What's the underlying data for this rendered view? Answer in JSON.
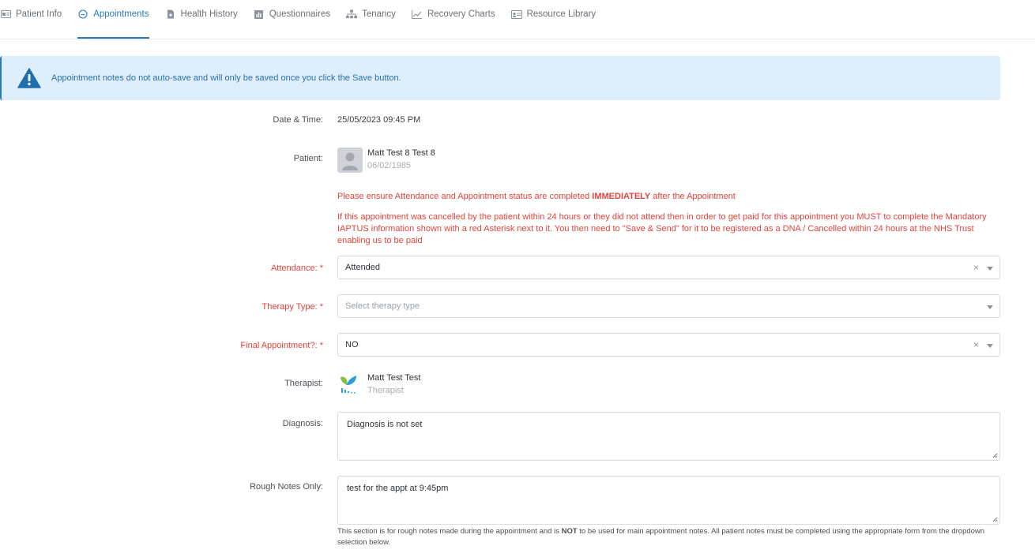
{
  "tabs": [
    {
      "label": "Patient Info",
      "icon": "id-card-icon"
    },
    {
      "label": "Appointments",
      "icon": "clock-icon",
      "active": true
    },
    {
      "label": "Health History",
      "icon": "document-plus-icon"
    },
    {
      "label": "Questionnaires",
      "icon": "bar-chart-icon"
    },
    {
      "label": "Tenancy",
      "icon": "hierarchy-icon"
    },
    {
      "label": "Recovery Charts",
      "icon": "line-chart-icon"
    },
    {
      "label": "Resource Library",
      "icon": "address-card-icon"
    }
  ],
  "alert": {
    "message": "Appointment notes do not auto-save and will only be saved once you click the Save button."
  },
  "form": {
    "datetime_label": "Date & Time:",
    "datetime_value": "25/05/2023 09:45 PM",
    "patient_label": "Patient:",
    "patient_name": "Matt Test 8 Test 8",
    "patient_dob": "06/02/1985",
    "warning1_a": "Please ensure Attendance and Appointment status are completed ",
    "warning1_b": "IMMEDIATELY",
    "warning1_c": " after the Appointment",
    "warning2": "If this appointment was cancelled by the patient within 24 hours or they did not attend then in order to get paid for this appointment you MUST to complete the Mandatory IAPTUS information shown with a red Asterisk next to it. You then need to \"Save & Send\" for it to be registered as a DNA / Cancelled within 24 hours at the NHS Trust enabling us to be paid",
    "attendance_label": "Attendance: *",
    "attendance_value": "Attended",
    "therapy_label": "Therapy Type: *",
    "therapy_placeholder": "Select therapy type",
    "final_label": "Final Appointment?: *",
    "final_value": "NO",
    "therapist_label": "Therapist:",
    "therapist_name": "Matt Test Test",
    "therapist_role": "Therapist",
    "diagnosis_label": "Diagnosis:",
    "diagnosis_value": "Diagnosis is not set",
    "notes_label": "Rough Notes Only:",
    "notes_value": "test for the appt at 9:45pm",
    "help_a": "This section is for rough notes made during the appointment and is ",
    "help_b": "NOT",
    "help_c": " to be used for main appointment notes. All patient notes must be completed using the appropriate form from the dropdown selection below.",
    "clear_glyph": "×"
  },
  "colors": {
    "accent": "#2a7ab8",
    "required": "#e0443e",
    "alert_bg": "#dfeefb"
  }
}
